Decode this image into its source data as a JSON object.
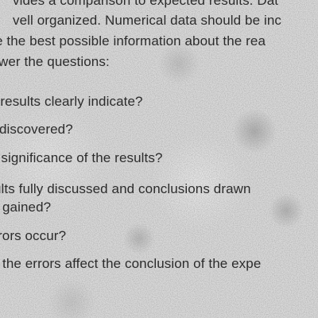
{
  "document": {
    "lines": [
      "vides a comparison to expected results. Dat",
      "vell organized. Numerical data should be inc",
      "e the best possible information about the rea",
      "wer the questions:",
      "e results clearly indicate?",
      "discovered?",
      "e significance of the results?",
      "ults fully discussed and conclusions drawn",
      "gained?",
      "rors occur?",
      "the errors affect the conclusion of the expe"
    ]
  }
}
